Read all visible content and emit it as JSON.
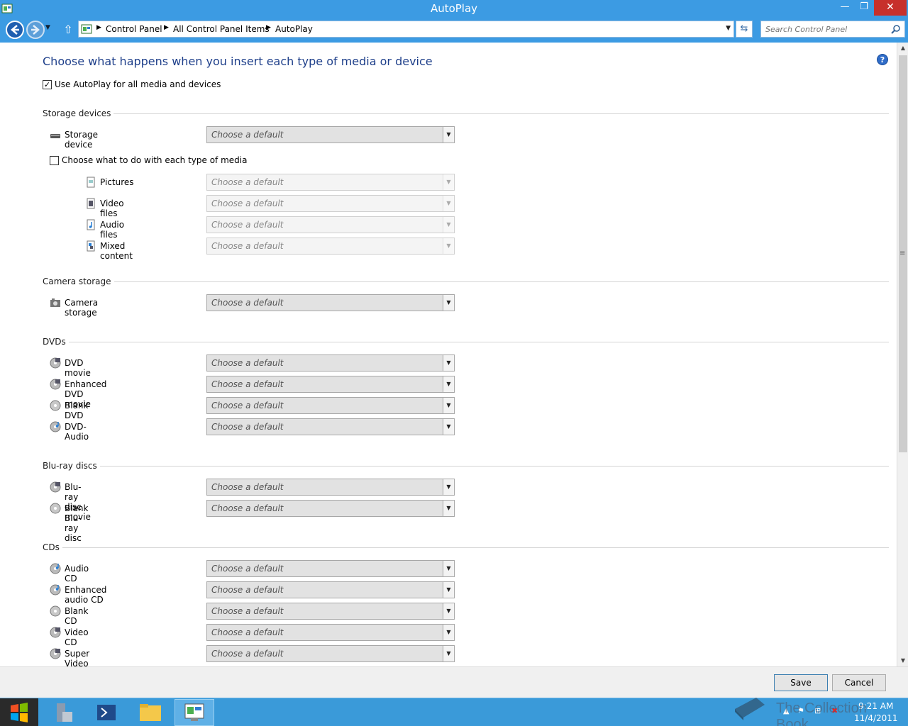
{
  "window": {
    "title": "AutoPlay",
    "minimize": "—",
    "maximize": "❐",
    "close": "✕"
  },
  "address": {
    "breadcrumbs": [
      "Control Panel",
      "All Control Panel Items",
      "AutoPlay"
    ],
    "search_placeholder": "Search Control Panel"
  },
  "page": {
    "title": "Choose what happens when you insert each type of media or device",
    "help": "?",
    "use_autoplay_label": "Use AutoPlay for all media and devices",
    "use_autoplay_checked": true
  },
  "sections": {
    "storage": {
      "label": "Storage devices",
      "device": {
        "name": "Storage device",
        "value": "Choose a default"
      },
      "per_media_label": "Choose what to do with each type of media",
      "per_media_checked": false,
      "media": [
        {
          "name": "Pictures",
          "value": "Choose a default"
        },
        {
          "name": "Video files",
          "value": "Choose a default"
        },
        {
          "name": "Audio files",
          "value": "Choose a default"
        },
        {
          "name": "Mixed content",
          "value": "Choose a default"
        }
      ]
    },
    "camera": {
      "label": "Camera storage",
      "items": [
        {
          "name": "Camera storage",
          "value": "Choose a default"
        }
      ]
    },
    "dvds": {
      "label": "DVDs",
      "items": [
        {
          "name": "DVD movie",
          "value": "Choose a default"
        },
        {
          "name": "Enhanced DVD movie",
          "value": "Choose a default"
        },
        {
          "name": "Blank DVD",
          "value": "Choose a default"
        },
        {
          "name": "DVD-Audio",
          "value": "Choose a default"
        }
      ]
    },
    "bluray": {
      "label": "Blu-ray discs",
      "items": [
        {
          "name": "Blu-ray disc movie",
          "value": "Choose a default"
        },
        {
          "name": "Blank Blu-ray disc",
          "value": "Choose a default"
        }
      ]
    },
    "cds": {
      "label": "CDs",
      "items": [
        {
          "name": "Audio CD",
          "value": "Choose a default"
        },
        {
          "name": "Enhanced audio CD",
          "value": "Choose a default"
        },
        {
          "name": "Blank CD",
          "value": "Choose a default"
        },
        {
          "name": "Video CD",
          "value": "Choose a default"
        },
        {
          "name": "Super Video CD",
          "value": "Choose a default"
        }
      ]
    }
  },
  "footer": {
    "save": "Save",
    "cancel": "Cancel"
  },
  "taskbar": {
    "time": "9:21 AM",
    "date": "11/4/2011"
  },
  "watermark": "The Collection Book",
  "colors": {
    "titlebar": "#3c9be3",
    "heading": "#1e3f8a",
    "close": "#c7302b"
  }
}
